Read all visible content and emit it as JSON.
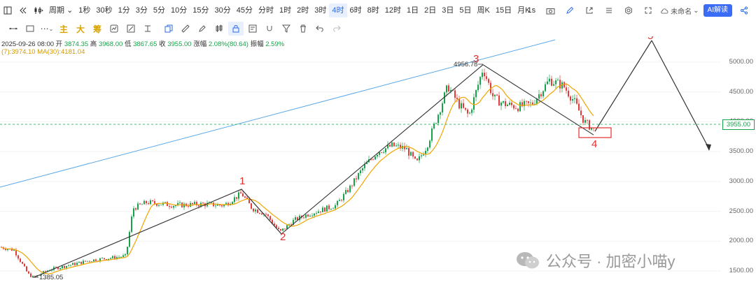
{
  "toolbar": {
    "period_label": "周期",
    "timeframes": [
      "1秒",
      "30秒",
      "1分",
      "3分",
      "5分",
      "10分",
      "15分",
      "30分",
      "45分",
      "分时",
      "1时",
      "2时",
      "3时",
      "4时",
      "6时",
      "8时",
      "12时",
      "1日",
      "2日",
      "3日",
      "5日",
      "周K",
      "15日",
      "月K"
    ],
    "active_timeframe": "4时",
    "interval_label": "1s",
    "name_label": "未命名",
    "ai_label": "AI解读"
  },
  "toolbar2": {
    "main_label": "主",
    "big_label": "大",
    "chip_label": "筹"
  },
  "ohlc": {
    "date": "2025-09-26 08:00",
    "open_label": "开",
    "open": "3874.35",
    "high_label": "高",
    "high": "3968.00",
    "low_label": "低",
    "low": "3867.65",
    "close_label": "收",
    "close": "3955.00",
    "change_label": "涨幅",
    "change": "2.08%(80.64)",
    "amp_label": "振幅",
    "amp": "2.59%"
  },
  "ma": {
    "ma7": "(7):3974.10",
    "ma30": "MA(30):4181.04"
  },
  "price_axis": {
    "ticks": [
      "5000.00",
      "4500.00",
      "4000.00",
      "3500.00",
      "3000.00",
      "2500.00",
      "2000.00",
      "1500.00"
    ],
    "current": "3955.00"
  },
  "annotations": {
    "wave1": "1",
    "wave2": "2",
    "wave3": "3",
    "wave4": "4",
    "wave5": "5",
    "high_label": "4956.78",
    "low_label": "1385.05"
  },
  "colors": {
    "up": "#16a34a",
    "down": "#e23b3b",
    "ma7": "#f0a500",
    "wave_red": "#e03030",
    "trendline": "#5aa8e8"
  },
  "watermark": {
    "text": "公众号 · 加密小喵y"
  },
  "chart_data": {
    "type": "candlestick",
    "title": "",
    "ylabel": "",
    "ylim": [
      1400,
      5300
    ],
    "current_price": 3955.0,
    "waves": [
      {
        "label": "1",
        "price": 2870
      },
      {
        "label": "2",
        "price": 2120
      },
      {
        "label": "3",
        "price": 4956.78
      },
      {
        "label": "4",
        "price": 3780
      },
      {
        "label": "5",
        "price": 5330
      }
    ],
    "marked_low": 1385.05,
    "marked_high": 4956.78
  }
}
